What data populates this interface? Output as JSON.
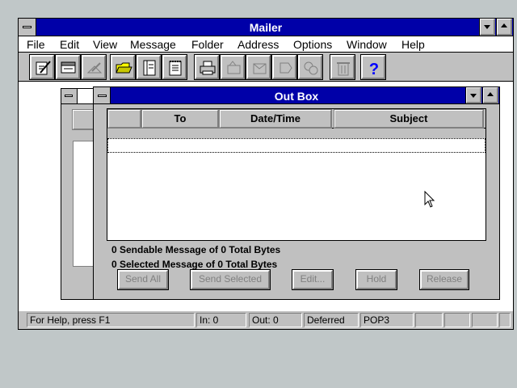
{
  "app": {
    "title": "Mailer"
  },
  "menu": [
    "File",
    "Edit",
    "View",
    "Message",
    "Folder",
    "Address",
    "Options",
    "Window",
    "Help"
  ],
  "toolbar": {
    "tools": [
      "compose-icon",
      "read-icon",
      "reply-icon",
      "open-folder-icon",
      "address-book-icon",
      "notepad-icon",
      "print-icon",
      "send-icon",
      "forward-icon",
      "retrieve-icon",
      "transfer-icon",
      "trash-icon",
      "help-icon"
    ],
    "help_glyph": "?"
  },
  "outbox": {
    "title": "Out Box",
    "columns": [
      "",
      "To",
      "Date/Time",
      "Subject"
    ],
    "status_sendable": "0 Sendable Message of 0 Total Bytes",
    "status_selected": "0 Selected Message of 0 Total Bytes",
    "buttons": [
      "Send All",
      "Send Selected",
      "Edit...",
      "Hold",
      "Release"
    ]
  },
  "statusbar": {
    "help": "For Help, press F1",
    "in": "In: 0",
    "out": "Out: 0",
    "mode": "Deferred",
    "protocol": "POP3"
  },
  "colors": {
    "titlebar": "#0000a8",
    "face": "#c0c0c0",
    "desktop": "#c0c7c8"
  }
}
